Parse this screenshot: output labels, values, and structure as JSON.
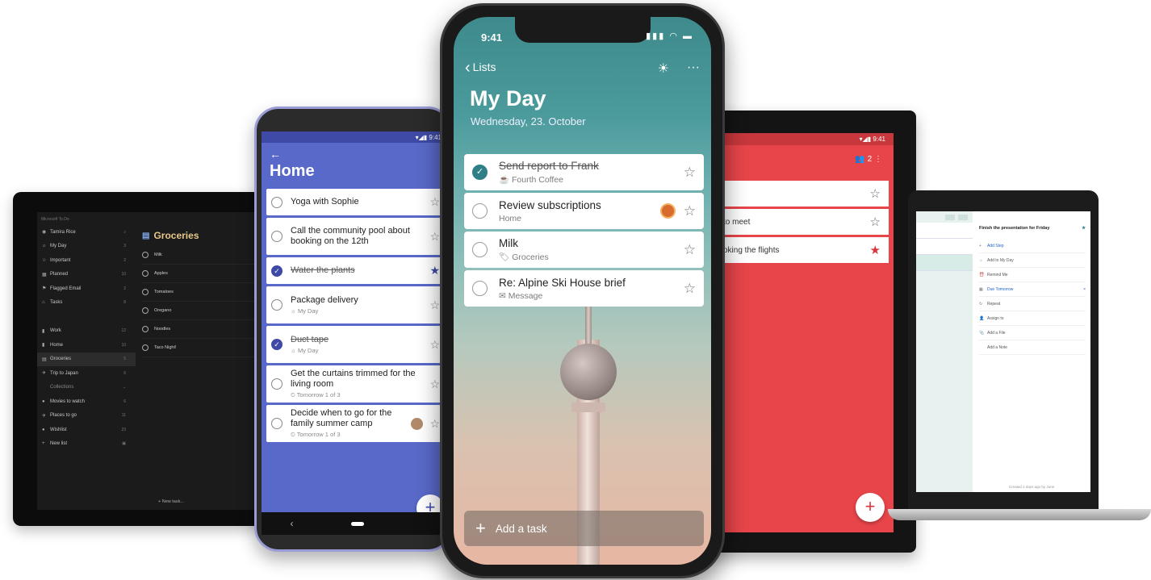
{
  "tablet": {
    "app_name": "Microsoft To Do",
    "sidebar": [
      {
        "icon": "user-avatar-icon",
        "glyph": "◉",
        "label": "Tamira Rice",
        "count": "⌕"
      },
      {
        "icon": "sun-icon",
        "glyph": "☼",
        "label": "My Day",
        "count": "3"
      },
      {
        "icon": "star-icon",
        "glyph": "☆",
        "label": "Important",
        "count": "2"
      },
      {
        "icon": "calendar-icon",
        "glyph": "▦",
        "label": "Planned",
        "count": "10"
      },
      {
        "icon": "flag-icon",
        "glyph": "⚑",
        "label": "Flagged Email",
        "count": "2"
      },
      {
        "icon": "home-icon",
        "glyph": "⌂",
        "label": "Tasks",
        "count": "8"
      },
      {
        "icon": "",
        "glyph": "",
        "label": "",
        "count": ""
      },
      {
        "icon": "briefcase-icon",
        "glyph": "▮",
        "label": "Work",
        "count": "12"
      },
      {
        "icon": "house-icon",
        "glyph": "▮",
        "label": "Home",
        "count": "10"
      },
      {
        "icon": "list-icon",
        "glyph": "▤",
        "label": "Groceries",
        "count": "5",
        "selected": true
      },
      {
        "icon": "plane-icon",
        "glyph": "✈",
        "label": "Trip to Japan",
        "count": "6"
      },
      {
        "icon": "",
        "glyph": "",
        "label": "Collections",
        "count": "⌄",
        "heading": true
      },
      {
        "icon": "movie-icon",
        "glyph": "●",
        "label": "Movies to watch",
        "count": "6"
      },
      {
        "icon": "plane-icon",
        "glyph": "✈",
        "label": "Places to go",
        "count": "11"
      },
      {
        "icon": "gift-icon",
        "glyph": "●",
        "label": "Wishlist",
        "count": "23"
      },
      {
        "icon": "plus-icon",
        "glyph": "+",
        "label": "New list",
        "count": "▣"
      }
    ],
    "list_title": "Groceries",
    "tasks": [
      "Milk",
      "Apples",
      "Tomatoes",
      "Oregano",
      "Noodles",
      "Taco Night!"
    ],
    "new_task": "+  New task..."
  },
  "android": {
    "status": "▾◢▮  9:41",
    "back": "←",
    "title": "Home",
    "tasks": [
      {
        "name": "Yoga with Sophie",
        "sub": "",
        "done": false,
        "star": "☆",
        "starred": false,
        "avatar": false,
        "tall": false
      },
      {
        "name": "Call the community pool about booking on the 12th",
        "sub": "",
        "done": false,
        "star": "☆",
        "starred": false,
        "avatar": false,
        "tall": true
      },
      {
        "name": "Water the plants",
        "sub": "",
        "done": true,
        "star": "★",
        "starred": true,
        "avatar": false,
        "tall": false
      },
      {
        "name": "Package delivery",
        "sub": "☼ My Day",
        "done": false,
        "star": "☆",
        "starred": false,
        "avatar": false,
        "tall": true
      },
      {
        "name": "Duct tape",
        "sub": "☼ My Day",
        "done": true,
        "star": "☆",
        "starred": false,
        "avatar": false,
        "tall": true
      },
      {
        "name": "Get the curtains trimmed for the living room",
        "sub": "⏲ Tomorrow  1 of 3",
        "done": false,
        "star": "☆",
        "starred": false,
        "avatar": false,
        "tall": true
      },
      {
        "name": "Decide when to go for the family summer camp",
        "sub": "⏲ Tomorrow  1 of 3",
        "done": false,
        "star": "☆",
        "starred": false,
        "avatar": true,
        "tall": true
      }
    ],
    "fab": "+",
    "nav_back": "‹"
  },
  "iphone": {
    "time": "9:41",
    "status_icons": "▮▮▮ ◠ ▬",
    "back_label": "Lists",
    "back_chevron": "‹",
    "suggestions_icon": "☀",
    "more_icon": "···",
    "title": "My Day",
    "date": "Wednesday, 23. October",
    "tasks": [
      {
        "name": "Send report to Frank",
        "sub": "☕ Fourth Coffee",
        "done": true,
        "avatar": false
      },
      {
        "name": "Review subscriptions",
        "sub": "Home",
        "done": false,
        "avatar": true
      },
      {
        "name": "Milk",
        "sub": "🏷 Groceries",
        "done": false,
        "avatar": false
      },
      {
        "name": "Re: Alpine Ski House brief",
        "sub": "✉ Message",
        "done": false,
        "avatar": false
      }
    ],
    "add_task_plus": "+",
    "add_task": "Add a task"
  },
  "red_tablet": {
    "status": "▾◢▮   9:41",
    "icons": "👥 2   ⋮",
    "tasks": [
      {
        "name": "",
        "star": "☆",
        "starred": false
      },
      {
        "name": "to meet",
        "star": "☆",
        "starred": false
      },
      {
        "name": "oking the flights",
        "star": "★",
        "starred": true
      }
    ],
    "fab": "+"
  },
  "laptop": {
    "detail_title": "Finish the presentation for Friday",
    "detail_star": "★",
    "items": [
      {
        "icon": "+",
        "label": "Add Step",
        "blue": true
      },
      {
        "icon": "☼",
        "label": "Add to My Day",
        "blue": false
      },
      {
        "icon": "⏰",
        "label": "Remind Me",
        "blue": false
      },
      {
        "icon": "▦",
        "label": "Due Tomorrow",
        "blue": true,
        "close": "×"
      },
      {
        "icon": "↻",
        "label": "Repeat",
        "blue": false
      },
      {
        "icon": "👤",
        "label": "Assign to",
        "blue": false
      },
      {
        "icon": "📎",
        "label": "Add a File",
        "blue": false
      },
      {
        "icon": "",
        "label": "Add a Note",
        "blue": false
      }
    ],
    "footer": "Created 2 days ago by June"
  },
  "colors": {
    "android_accent": "#5969c9",
    "iphone_accent": "#2e7f86",
    "red_accent": "#e8454a",
    "tablet_bg": "#1b1b1b"
  }
}
